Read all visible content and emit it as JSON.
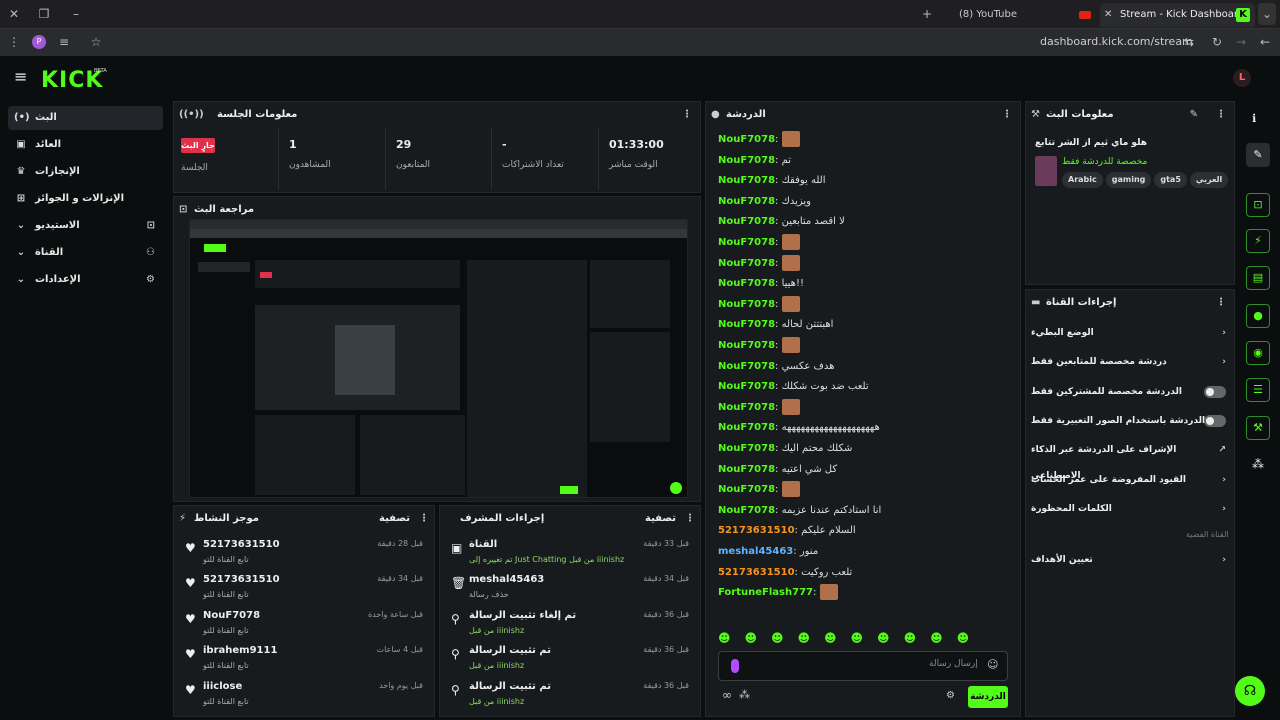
{
  "browser": {
    "tab_youtube": "(8) YouTube",
    "tab_kick": "Stream - Kick Dashboard",
    "address": "dashboard.kick.com/stream"
  },
  "app": {
    "logo": "KICK",
    "logo_sup": "BETA",
    "avatar": "L"
  },
  "sidebar": {
    "items": [
      {
        "label": "البث",
        "icon": "broadcast-icon"
      },
      {
        "label": "العائد",
        "icon": "dollar-icon"
      },
      {
        "label": "الإنجازات",
        "icon": "trophy-icon"
      },
      {
        "label": "الإنزالات و الجوائز",
        "icon": "gift-icon"
      },
      {
        "label": "الاستيديو",
        "icon": "studio-icon"
      },
      {
        "label": "القناة",
        "icon": "channel-icon"
      },
      {
        "label": "الإعدادات",
        "icon": "gear-icon"
      }
    ]
  },
  "session": {
    "title": "معلومات الجلسة",
    "live_badge": "جارٍ البث",
    "session_label": "الجلسة",
    "viewers_value": "1",
    "viewers_label": "المشاهدون",
    "followers_value": "29",
    "followers_label": "المتابعون",
    "subs_value": "-",
    "subs_label": "تعداد الاشتراكات",
    "time_value": "01:33:00",
    "time_label": "الوقت مباشر"
  },
  "preview": {
    "title": "مراجعة البث"
  },
  "activity": {
    "title": "موجز النشاط",
    "filter": "تصفية",
    "items": [
      {
        "name": "52173631510",
        "sub": "تابع القناة للتو",
        "time": "قبل 28 دقيقة"
      },
      {
        "name": "52173631510",
        "sub": "تابع القناة للتو",
        "time": "قبل 34 دقيقة"
      },
      {
        "name": "NouF7078",
        "sub": "تابع القناة للتو",
        "time": "قبل ساعة واحدة"
      },
      {
        "name": "ibrahem9111",
        "sub": "تابع القناة للتو",
        "time": "قبل 4 ساعات"
      },
      {
        "name": "iiiclose",
        "sub": "تابع القناة للتو",
        "time": "قبل يوم واحد"
      }
    ]
  },
  "modactions": {
    "title": "إجراءات المشرف",
    "filter": "تصفية",
    "items": [
      {
        "title": "القناة",
        "sub": "تم تغييره إلى Just Chatting من قبل iiinishz",
        "time": "قبل 33 دقيقة"
      },
      {
        "title": "meshal45463",
        "sub": "حذف رسالة",
        "time": "قبل 34 دقيقة"
      },
      {
        "title": "تم إلغاء تثبيت الرسالة",
        "sub": "من قبل iiinishz",
        "time": "قبل 36 دقيقة"
      },
      {
        "title": "تم تثبيت الرسالة",
        "sub": "من قبل iiinishz",
        "time": "قبل 36 دقيقة"
      },
      {
        "title": "تم تثبيت الرسالة",
        "sub": "من قبل iiinishz",
        "time": "قبل 36 دقيقة"
      }
    ]
  },
  "chat": {
    "title": "الدردشة",
    "placeholder": "إرسال رسالة",
    "send": "الدردشة",
    "messages": [
      {
        "user": "NouF7078",
        "text": "",
        "emote": true,
        "color": "#53fc18"
      },
      {
        "user": "NouF7078",
        "text": "تم",
        "emote": false,
        "color": "#53fc18"
      },
      {
        "user": "NouF7078",
        "text": "الله يوفقك",
        "emote": false,
        "color": "#53fc18"
      },
      {
        "user": "NouF7078",
        "text": "ويزيدك",
        "emote": false,
        "color": "#53fc18"
      },
      {
        "user": "NouF7078",
        "text": "لا اقصد متابعين",
        "emote": false,
        "color": "#53fc18"
      },
      {
        "user": "NouF7078",
        "text": "",
        "emote": true,
        "color": "#53fc18"
      },
      {
        "user": "NouF7078",
        "text": "",
        "emote": true,
        "color": "#53fc18"
      },
      {
        "user": "NouF7078",
        "text": "هييا!!",
        "emote": false,
        "color": "#53fc18"
      },
      {
        "user": "NouF7078",
        "text": "",
        "emote": true,
        "color": "#53fc18"
      },
      {
        "user": "NouF7078",
        "text": "اهبتتتن لحاله",
        "emote": false,
        "color": "#53fc18"
      },
      {
        "user": "NouF7078",
        "text": "",
        "emote": true,
        "color": "#53fc18"
      },
      {
        "user": "NouF7078",
        "text": "هدف عكسي",
        "emote": false,
        "color": "#53fc18"
      },
      {
        "user": "NouF7078",
        "text": "تلعب ضد بوت شكلك",
        "emote": false,
        "color": "#53fc18"
      },
      {
        "user": "NouF7078",
        "text": "",
        "emote": true,
        "color": "#53fc18"
      },
      {
        "user": "NouF7078",
        "text": "ههههههههههههههههههههه",
        "emote": false,
        "color": "#53fc18"
      },
      {
        "user": "NouF7078",
        "text": "شكلك محتم اليك",
        "emote": false,
        "color": "#53fc18"
      },
      {
        "user": "NouF7078",
        "text": "كل شي اعتيه",
        "emote": false,
        "color": "#53fc18"
      },
      {
        "user": "NouF7078",
        "text": "",
        "emote": true,
        "color": "#53fc18"
      },
      {
        "user": "NouF7078",
        "text": "انا استادكتم عندنا عزيمه",
        "emote": false,
        "color": "#53fc18"
      },
      {
        "user": "52173631510",
        "text": "السلام عليكم",
        "emote": false,
        "color": "#f7931e"
      },
      {
        "user": "meshal45463",
        "text": "منور",
        "emote": false,
        "color": "#5db4ff"
      },
      {
        "user": "52173631510",
        "text": "تلعب روكيت",
        "emote": false,
        "color": "#f7931e"
      },
      {
        "user": "FortuneFlash777",
        "text": "",
        "emote": true,
        "color": "#53fc18"
      }
    ]
  },
  "streaminfo": {
    "title": "معلومات البث",
    "stream_title": "هلو ماي ثيم از الشر تتابع",
    "category": "مخصصة للدردشة فقط",
    "tags": [
      "Arabic",
      "gaming",
      "gta5",
      "العربي"
    ]
  },
  "channel_actions": {
    "title": "إجراءات القناة",
    "items": [
      {
        "label": "الوضع البطيء",
        "type": "chevron"
      },
      {
        "label": "دردشة مخصصة للمتابعين فقط",
        "type": "chevron"
      },
      {
        "label": "الدردشة مخصصة للمشتركين فقط",
        "type": "toggle"
      },
      {
        "label": "الدردشة باستخدام الصور التعبيرية فقط",
        "type": "toggle"
      },
      {
        "label": "الإشراف على الدردشة عبر الذكاء الاصطناعي",
        "type": "external"
      },
      {
        "label": "القيود المفروضة على عمر الحساب",
        "type": "chevron"
      },
      {
        "label": "الكلمات المحظورة",
        "type": "chevron"
      }
    ],
    "section": "القناة الفضية",
    "goal": "تعيين الأهداف"
  }
}
